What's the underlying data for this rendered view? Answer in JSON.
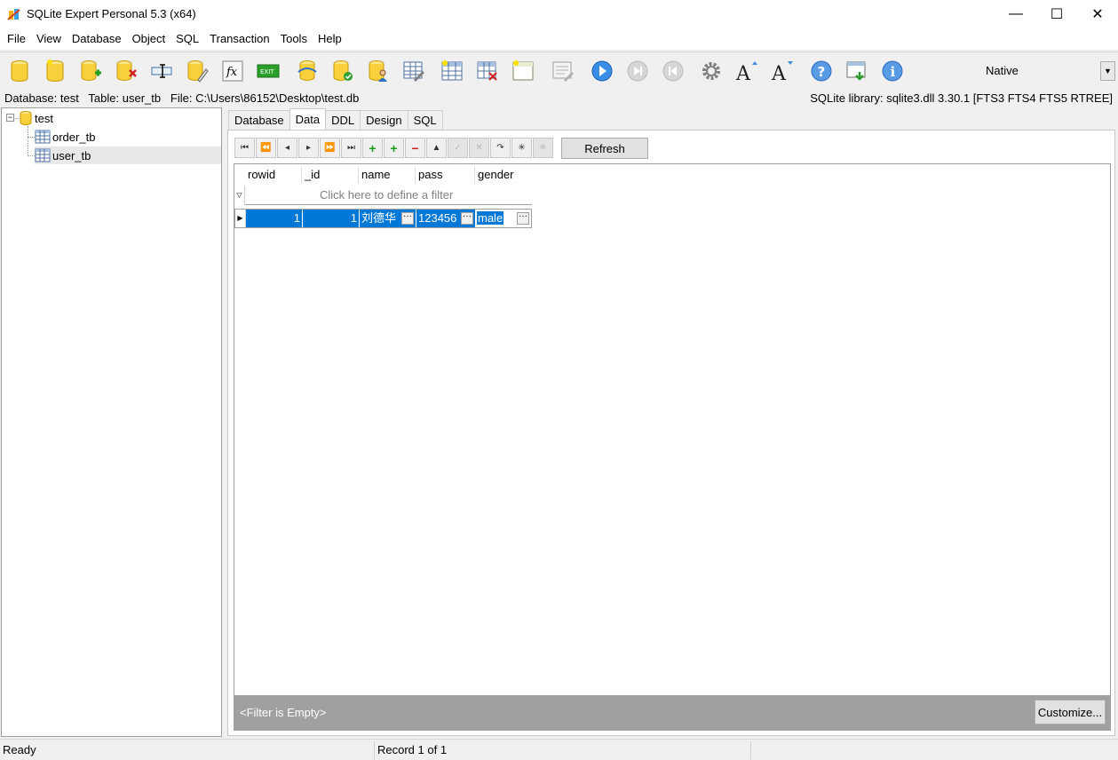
{
  "window": {
    "title": "SQLite Expert Personal 5.3 (x64)",
    "minimize": "—",
    "maximize": "☐",
    "close": "✕"
  },
  "menu": [
    "File",
    "View",
    "Database",
    "Object",
    "SQL",
    "Transaction",
    "Tools",
    "Help"
  ],
  "toolbar": {
    "native_select_value": "Native",
    "icons": [
      "open-database-icon",
      "new-database-icon",
      "attach-database-icon",
      "detach-database-icon",
      "rename-icon",
      "edit-sql-icon",
      "function-icon",
      "exit-icon",
      "refresh-database-icon",
      "vacuum-database-icon",
      "security-icon",
      "design-table-icon",
      "new-table-icon",
      "delete-table-icon",
      "new-view-icon",
      "edit-view-icon",
      "execute-icon",
      "step-icon",
      "stop-icon",
      "settings-icon",
      "increase-font-icon",
      "decrease-font-icon",
      "help-icon",
      "window-icon",
      "info-icon"
    ]
  },
  "infobar": {
    "left": "Database: test   Table: user_tb   File: C:\\Users\\86152\\Desktop\\test.db",
    "right": "SQLite library: sqlite3.dll 3.30.1 [FTS3 FTS4 FTS5 RTREE]"
  },
  "tree": {
    "root": "test",
    "expander": "−",
    "tables": [
      "order_tb",
      "user_tb"
    ]
  },
  "tabs": [
    "Database",
    "Data",
    "DDL",
    "Design",
    "SQL"
  ],
  "active_tab": "Data",
  "nav": {
    "refresh_label": "Refresh"
  },
  "grid": {
    "columns": [
      "rowid",
      "_id",
      "name",
      "pass",
      "gender"
    ],
    "filter_placeholder": "Click here to define a filter",
    "rows": [
      {
        "rowid": "1",
        "_id": "1",
        "name": "刘德华",
        "pass": "123456",
        "gender": "male"
      }
    ],
    "ellipsis": "···",
    "footer_filter": "<Filter is Empty>",
    "customize_label": "Customize..."
  },
  "status": {
    "left": "Ready",
    "record": "Record 1 of 1"
  }
}
